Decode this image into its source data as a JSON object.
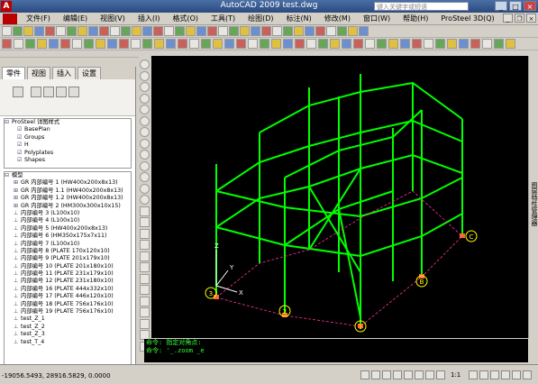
{
  "window": {
    "title": "AutoCAD 2009  test.dwg",
    "search_placeholder": "键入关键字或短语"
  },
  "menu": [
    "文件(F)",
    "编辑(E)",
    "视图(V)",
    "插入(I)",
    "格式(O)",
    "工具(T)",
    "绘图(D)",
    "标注(N)",
    "修改(M)",
    "窗口(W)",
    "帮助(H)",
    "ProSteel 3D(Q)"
  ],
  "toolbar": {
    "combo_value": ""
  },
  "left_panel": {
    "tabs": [
      "零件",
      "视图",
      "插入",
      "设置"
    ],
    "tree1": {
      "root": "ProSteel 详图样式",
      "items": [
        "BasePlan",
        "Groups",
        "H",
        "Polyplates",
        "Shapes"
      ]
    },
    "tree2": {
      "root": "模型",
      "items": [
        "GR 内部编号 1 (HW400x200x8x13)",
        "GR 内部编号 1.1 (HW400x200x8x13)",
        "GR 内部编号 1.2 (HW400x200x8x13)",
        "GR 内部编号 2 (HM300x300x10x15)",
        "内部编号 3 (L100x10)",
        "内部编号 4 (L100x10)",
        "内部编号 5 (HW400x200x8x13)",
        "内部编号 6 (HM350x175x7x11)",
        "内部编号 7 (L100x10)",
        "内部编号 8 (PLATE 170x120x10)",
        "内部编号 9 (PLATE 201x179x10)",
        "内部编号 10 (PLATE 201x180x10)",
        "内部编号 11 (PLATE 231x179x10)",
        "内部编号 12 (PLATE 231x180x10)",
        "内部编号 16 (PLATE 444x332x10)",
        "内部编号 17 (PLATE 446x120x10)",
        "内部编号 18 (PLATE 756x176x10)",
        "内部编号 19 (PLATE 756x176x10)",
        "test_Z_1",
        "test_Z_2",
        "test_Z_3",
        "test_T_4"
      ]
    }
  },
  "canvas": {
    "grid_labels": [
      "A",
      "B",
      "C",
      "1",
      "2",
      "3"
    ],
    "axis_labels": [
      "X",
      "Y",
      "Z"
    ]
  },
  "right_strip_label": "图层特性管理器",
  "command": {
    "line1": "命令: 指定对角点:",
    "line2": "命令: '_.zoom _e"
  },
  "status": {
    "coords": "-19056.5493, 28916.5829, 0.0000",
    "scale": "1:1"
  },
  "colors": {
    "accent": "#00ff00",
    "canvas": "#000000",
    "title_bar": "#2a4a7f"
  }
}
